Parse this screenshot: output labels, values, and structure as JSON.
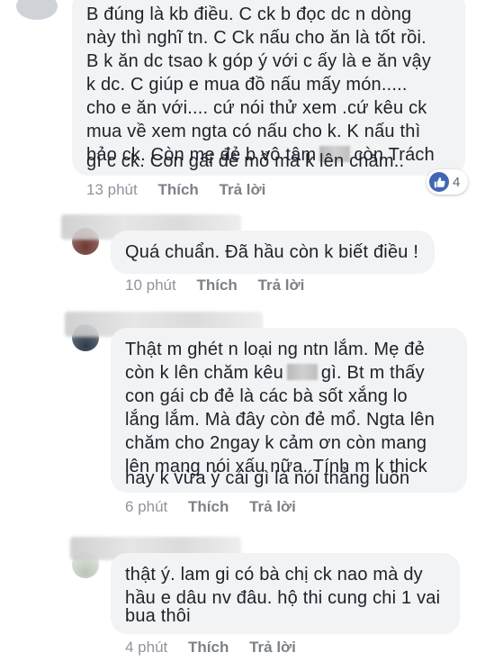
{
  "comments": [
    {
      "lines": [
        "B đúng là kb điều. C ck b đọc dc n dòng",
        "này thì nghĩ tn. C Ck nấu cho ăn là tốt rồi.",
        "B k ăn dc tsao k góp ý với c ấy là e ăn vậy",
        "k dc. C giúp e mua đồ nấu mấy món.....",
        "cho e ăn với.... cứ nói thử xem .cứ kêu ck",
        "mua về xem ngta có nấu cho k. K nấu thì",
        "bảo ck. Còn mẹ đẻ b vô tâm",
        "còn Trách",
        "gì c ck. Con gái đẻ mổ mà k lên chăm.."
      ],
      "time": "13 phút",
      "like_label": "Thích",
      "reply_label": "Trả lời",
      "reaction_count": "4"
    },
    {
      "lines": [
        "Quá chuẩn. Đã hầu còn k biết điều !"
      ],
      "time": "10 phút",
      "like_label": "Thích",
      "reply_label": "Trả lời"
    },
    {
      "lines": [
        "Thật m ghét n loại ng ntn lắm. Mẹ đẻ",
        "còn k lên chăm kêu",
        "gì. Bt m thấy",
        "con gái cb đẻ là các bà sốt xắng lo",
        "lắng lắm. Mà đây còn đẻ mổ. Ngta lên",
        "chăm cho 2ngay k cảm ơn còn mang",
        "lên mạng nói xấu nữa. Tính m k thick",
        "hay k vừa ý cái gì là nói thẳng luôn"
      ],
      "time": "6 phút",
      "like_label": "Thích",
      "reply_label": "Trả lời"
    },
    {
      "lines": [
        "thật ý. lam gi có bà chị ck nao mà dy",
        "hầu e dâu nv đâu. hộ thi cung chi 1 vai",
        "bua thôi"
      ],
      "time": "4 phút",
      "like_label": "Thích",
      "reply_label": "Trả lời"
    }
  ],
  "colors": {
    "bubble": "#f2f3f5",
    "meta": "#90949c",
    "like_blue": "#4267b2"
  },
  "icons": [
    "thumbs-up-icon"
  ]
}
